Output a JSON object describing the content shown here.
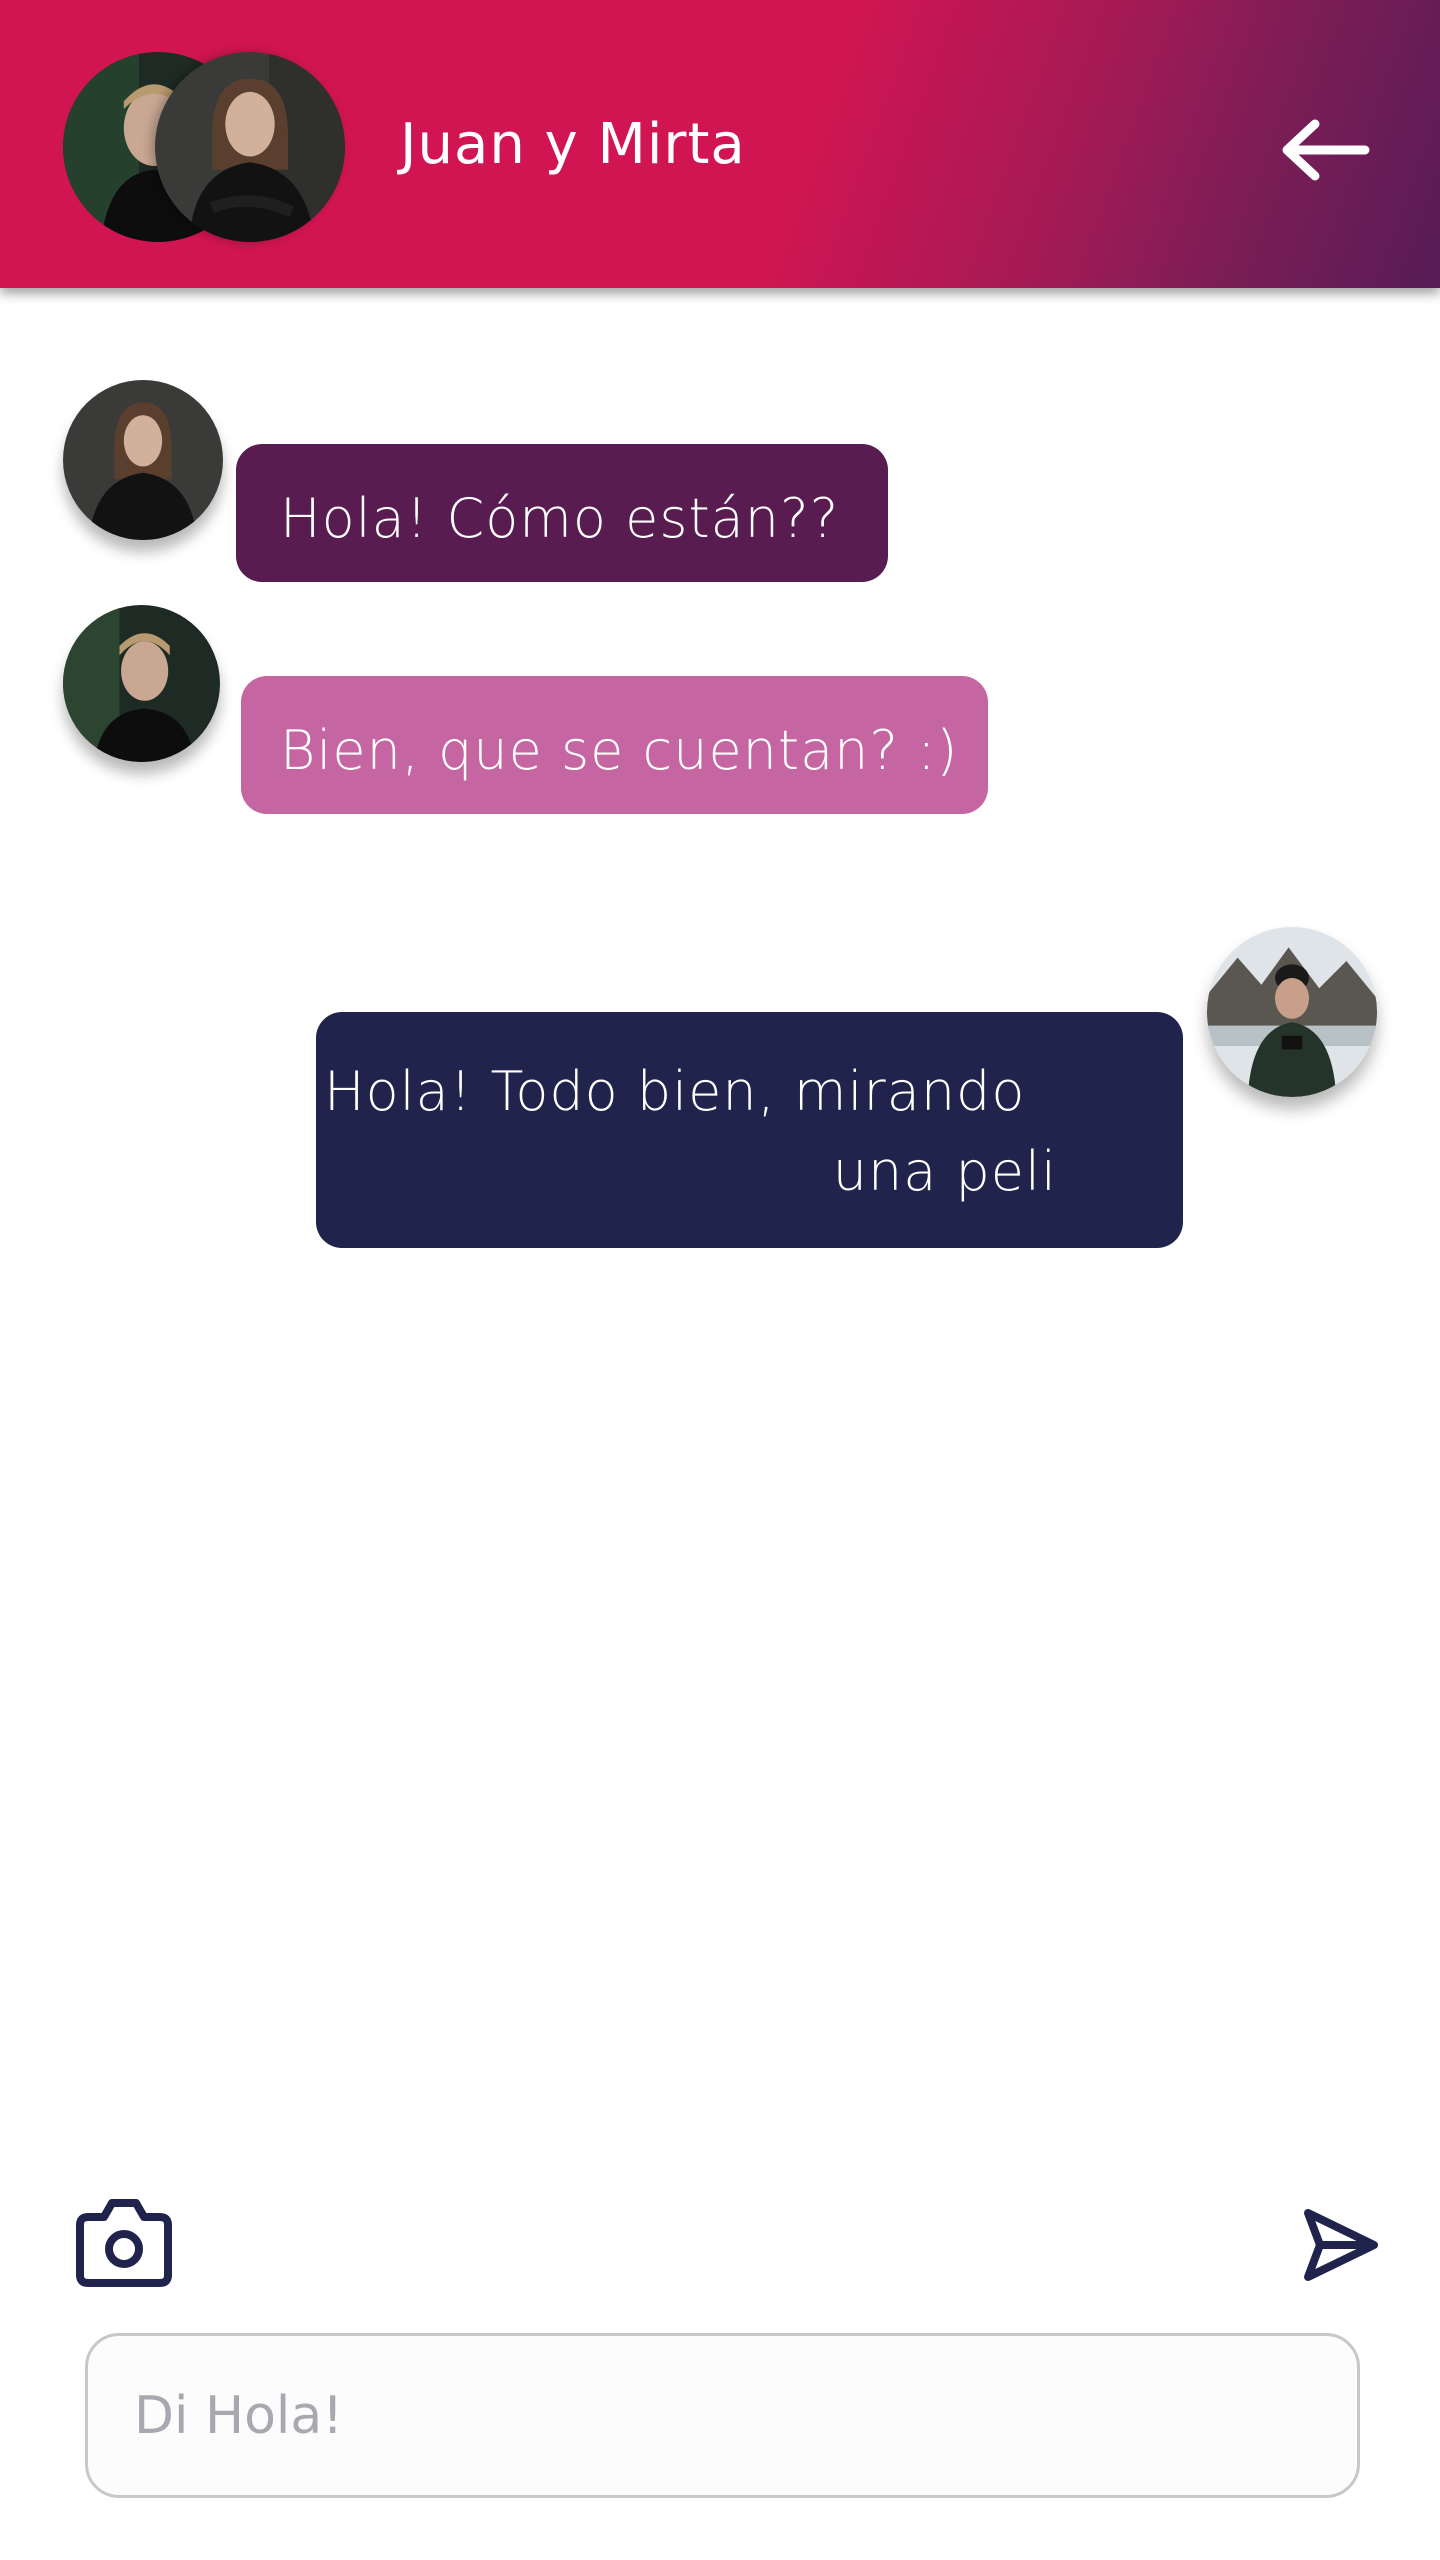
{
  "header": {
    "title": "Juan y Mirta",
    "back_icon": "arrow-left-icon",
    "gradient": [
      "#d11552",
      "#571c56"
    ]
  },
  "messages": [
    {
      "sender": "Mirta",
      "text": "Hola! Cómo están??",
      "color": "#581c50"
    },
    {
      "sender": "Juan",
      "text": "Bien, que se cuentan? :)",
      "color": "#c566a2"
    },
    {
      "sender": "me",
      "text_line1": "Hola! Todo bien, mirando",
      "text_line2": "una peli",
      "color": "#20244d"
    }
  ],
  "composer": {
    "camera_icon": "camera-icon",
    "send_icon": "send-icon",
    "placeholder": "Di Hola!",
    "value": ""
  },
  "colors": {
    "accent_dark": "#20244d",
    "input_border": "#c7c7cc"
  }
}
